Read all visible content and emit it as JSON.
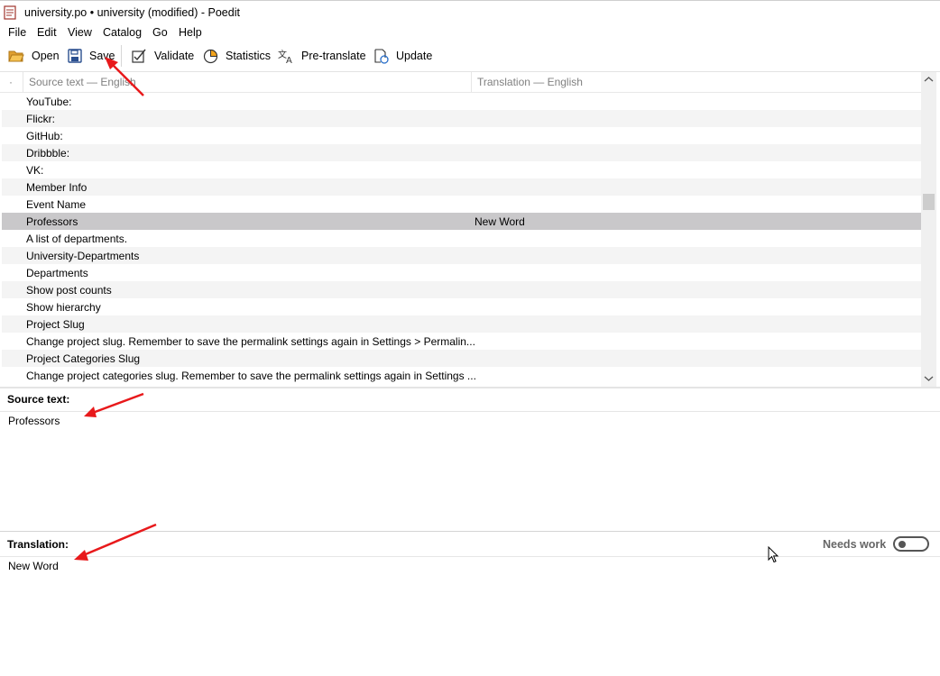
{
  "window": {
    "title": "university.po • university (modified) - Poedit"
  },
  "menu": [
    "File",
    "Edit",
    "View",
    "Catalog",
    "Go",
    "Help"
  ],
  "toolbar": {
    "open": "Open",
    "save": "Save",
    "validate": "Validate",
    "statistics": "Statistics",
    "pretranslate": "Pre-translate",
    "update": "Update"
  },
  "list": {
    "marker": "·",
    "col_source": "Source text — English",
    "col_translation": "Translation — English",
    "rows": [
      {
        "source": "YouTube:",
        "translation": ""
      },
      {
        "source": "Flickr:",
        "translation": ""
      },
      {
        "source": "GitHub:",
        "translation": ""
      },
      {
        "source": "Dribbble:",
        "translation": ""
      },
      {
        "source": "VK:",
        "translation": ""
      },
      {
        "source": "Member Info",
        "translation": ""
      },
      {
        "source": "Event Name",
        "translation": ""
      },
      {
        "source": "Professors",
        "translation": "New Word",
        "selected": true
      },
      {
        "source": "A list of departments.",
        "translation": ""
      },
      {
        "source": "University-Departments",
        "translation": ""
      },
      {
        "source": "Departments",
        "translation": ""
      },
      {
        "source": "Show post counts",
        "translation": ""
      },
      {
        "source": "Show hierarchy",
        "translation": ""
      },
      {
        "source": "Project Slug",
        "translation": ""
      },
      {
        "source": "Change project slug. Remember to save the permalink settings again in Settings > Permalin...",
        "translation": ""
      },
      {
        "source": "Project Categories Slug",
        "translation": ""
      },
      {
        "source": "Change project categories slug. Remember to save the permalink settings again in Settings ...",
        "translation": ""
      }
    ]
  },
  "source_panel": {
    "label": "Source text:",
    "text": "Professors"
  },
  "translation_panel": {
    "label": "Translation:",
    "text": "New Word",
    "needs_work_label": "Needs work",
    "needs_work": false
  },
  "colors": {
    "selected_row": "#c9c8ca",
    "alt_row": "#f4f4f4",
    "annotation_arrow": "#e8191b"
  }
}
